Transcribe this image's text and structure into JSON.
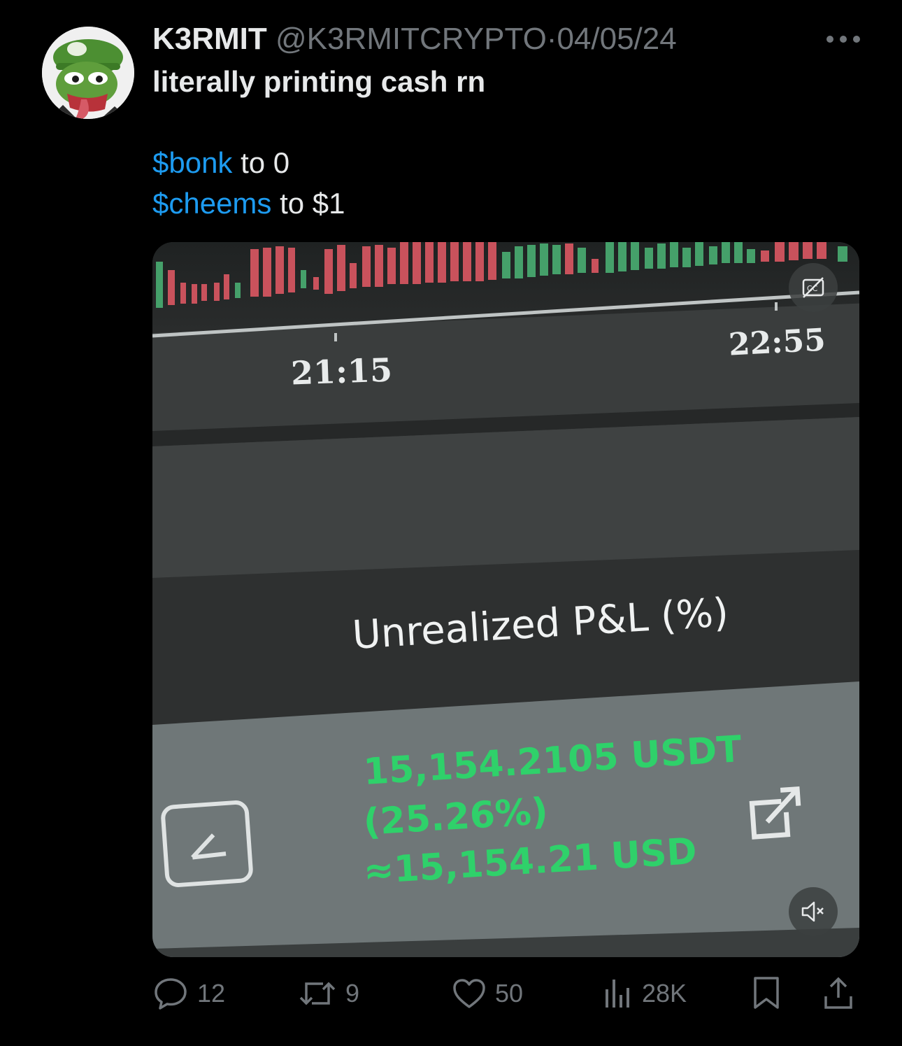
{
  "tweet": {
    "display_name": "K3RMIT",
    "handle": "@K3RMITCRYPTO",
    "separator": "·",
    "date": "04/05/24",
    "line1": "literally printing cash rn",
    "line2_tag": "$bonk",
    "line2_rest": " to 0",
    "line3_tag": "$cheems",
    "line3_rest": " to $1"
  },
  "media": {
    "time_label_1": "21:15",
    "time_label_2": "22:55",
    "pnl_title": "Unrealized P&L (%)",
    "pnl_usdt": "15,154.2105 USDT",
    "pnl_percent": "(25.26%)",
    "pnl_usd": "≈15,154.21 USD",
    "captions_icon": "captions-off-icon",
    "mute_icon": "volume-muted-icon"
  },
  "actions": {
    "replies": "12",
    "reposts": "9",
    "likes": "50",
    "views": "28K"
  },
  "colors": {
    "accent": "#1d9bf0",
    "muted": "#71767b",
    "candle_red": "#c9525c",
    "candle_green": "#45a06a",
    "pnl_green": "#2fd16a"
  }
}
